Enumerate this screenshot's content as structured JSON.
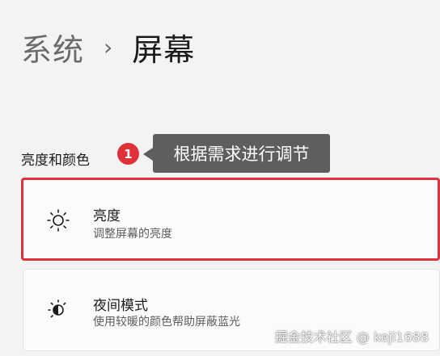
{
  "breadcrumb": {
    "parent": "系统",
    "separator": "›",
    "current": "屏幕"
  },
  "section": {
    "title": "亮度和颜色"
  },
  "annotation": {
    "badge": "1",
    "callout": "根据需求进行调节"
  },
  "cards": [
    {
      "title": "亮度",
      "subtitle": "调整屏幕的亮度",
      "icon": "sun-icon"
    },
    {
      "title": "夜间模式",
      "subtitle": "使用较暖的颜色帮助屏蔽蓝光",
      "icon": "night-mode-icon"
    }
  ],
  "watermark": "掘金技术社区 @ keji1688",
  "colors": {
    "accent_red": "#e0303a",
    "callout_bg": "#5e5e5e",
    "page_bg": "#f3f3f3"
  }
}
